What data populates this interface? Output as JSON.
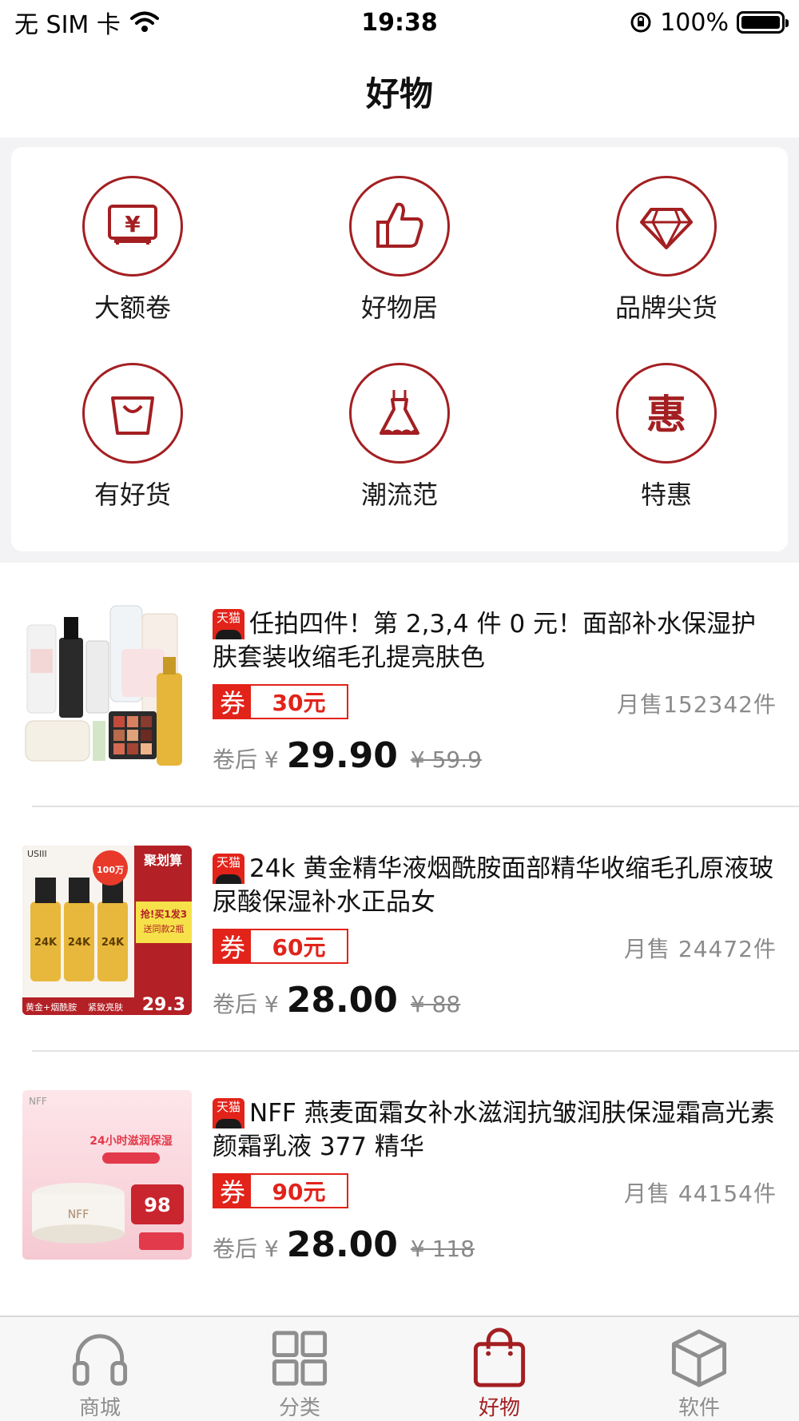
{
  "status_bar": {
    "carrier": "无 SIM 卡",
    "time": "19:38",
    "battery": "100%"
  },
  "header": {
    "title": "好物"
  },
  "categories": [
    {
      "label": "大额卷",
      "icon": "coupon-icon"
    },
    {
      "label": "好物居",
      "icon": "thumbs-up-icon"
    },
    {
      "label": "品牌尖货",
      "icon": "diamond-icon"
    },
    {
      "label": "有好货",
      "icon": "shopping-bag-icon"
    },
    {
      "label": "潮流范",
      "icon": "dress-icon"
    },
    {
      "label": "特惠",
      "icon": "hui-icon"
    }
  ],
  "category_icon_glyph": "惠",
  "products": [
    {
      "badge": "天猫",
      "title": "任拍四件！第 2,3,4 件 0 元！面部补水保湿护肤套装收缩毛孔提亮肤色",
      "coupon_tag": "券",
      "coupon_amount": "30元",
      "monthly_sales": "月售152342件",
      "price_prefix": "卷后 ¥",
      "price": "29.90",
      "original_price": "¥ 59.9",
      "image": "skincare-set-image"
    },
    {
      "badge": "天猫",
      "title": "24k 黄金精华液烟酰胺面部精华收缩毛孔原液玻尿酸保湿补水正品女",
      "coupon_tag": "券",
      "coupon_amount": "60元",
      "monthly_sales": "月售 24472件",
      "price_prefix": "卷后 ¥",
      "price": "28.00",
      "original_price": "¥ 88",
      "image": "gold-serum-image",
      "image_text": {
        "brand": "USIII",
        "banner": "聚划算",
        "promo": "抢!买1发3",
        "promo2": "送同款2瓶",
        "bottle_label": "24K",
        "bottom_left": "黄金+烟酰胺",
        "bottom_mid": "紧致亮肤",
        "bottom_price": "29.3",
        "sold": "100万"
      }
    },
    {
      "badge": "天猫",
      "title": "NFF 燕麦面霜女补水滋润抗皱润肤保湿霜高光素颜霜乳液 377 精华",
      "coupon_tag": "券",
      "coupon_amount": "90元",
      "monthly_sales": "月售 44154件",
      "price_prefix": "卷后 ¥",
      "price": "28.00",
      "original_price": "¥ 118",
      "image": "face-cream-image",
      "image_text": {
        "brand": "NFF",
        "headline": "24小时滋润保湿",
        "jar_label": "NFF",
        "price": "98"
      }
    }
  ],
  "tab_bar": [
    {
      "label": "商城",
      "icon": "headphones-icon",
      "active": false
    },
    {
      "label": "分类",
      "icon": "grid-icon",
      "active": false
    },
    {
      "label": "好物",
      "icon": "shopping-bag-icon",
      "active": true
    },
    {
      "label": "软件",
      "icon": "cube-icon",
      "active": false
    }
  ],
  "colors": {
    "accent": "#a31f22",
    "coupon_red": "#e2231a",
    "muted": "#8b8b8b"
  }
}
